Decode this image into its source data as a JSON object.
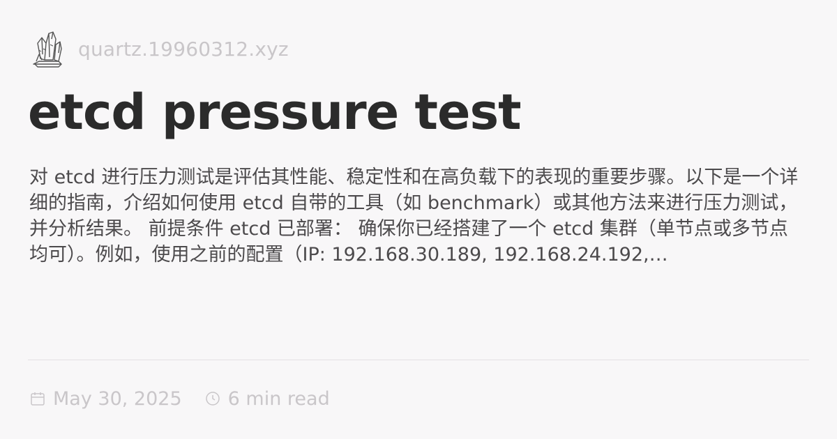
{
  "site": {
    "name": "quartz.19960312.xyz",
    "logo_icon": "crystal-logo-icon"
  },
  "article": {
    "title": "etcd pressure test",
    "description": "对 etcd 进行压力测试是评估其性能、稳定性和在高负载下的表现的重要步骤。以下是一个详细的指南，介绍如何使用 etcd 自带的工具（如 benchmark）或其他方法来进行压力测试，并分析结果。 前提条件 etcd 已部署： 确保你已经搭建了一个 etcd 集群（单节点或多节点均可）。例如，使用之前的配置（IP: 192.168.30.189, 192.168.24.192,…",
    "date": "May 30, 2025",
    "date_icon": "calendar-icon",
    "read_time": "6 min read",
    "read_time_icon": "clock-icon"
  },
  "colors": {
    "background": "#f8f7f8",
    "title": "#2b2b2b",
    "body_text": "#4c4a4c",
    "muted": "#c9c6c9",
    "divider": "#e3e1e3"
  }
}
